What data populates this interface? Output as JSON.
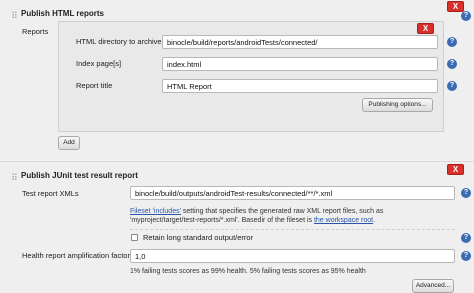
{
  "html_reports": {
    "title": "Publish HTML reports",
    "reports_label": "Reports",
    "delete_label": "X",
    "directory_label": "HTML directory to archive",
    "directory_value": "binocle/build/reports/androidTests/connected/",
    "index_label": "Index page[s]",
    "index_value": "index.html",
    "report_title_label": "Report title",
    "report_title_value": "HTML Report",
    "publishing_options_label": "Publishing options...",
    "add_label": "Add"
  },
  "junit": {
    "title": "Publish JUnit test result report",
    "delete_label": "X",
    "xmls_label": "Test report XMLs",
    "xmls_value": "binocle/build/outputs/androidTest-results/connected/**/*.xml",
    "fileset_link": "Fileset 'includes'",
    "fileset_desc_1": " setting that specifies the generated raw XML report files, such as",
    "fileset_desc_2": "'myproject/target/test-reports/*.xml'. Basedir of the fileset is ",
    "workspace_link": "the workspace root",
    "workspace_suffix": ".",
    "retain_label": "Retain long standard output/error",
    "health_label": "Health report amplification factor",
    "health_value": "1,0",
    "health_desc": "1% failing tests scores as 99% health. 5% failing tests scores as 95% health",
    "advanced_label": "Advanced..."
  },
  "help_glyph": "?",
  "colors": {
    "delete": "#d9302c",
    "help": "#3a6bb3",
    "link": "#2a55a8"
  }
}
